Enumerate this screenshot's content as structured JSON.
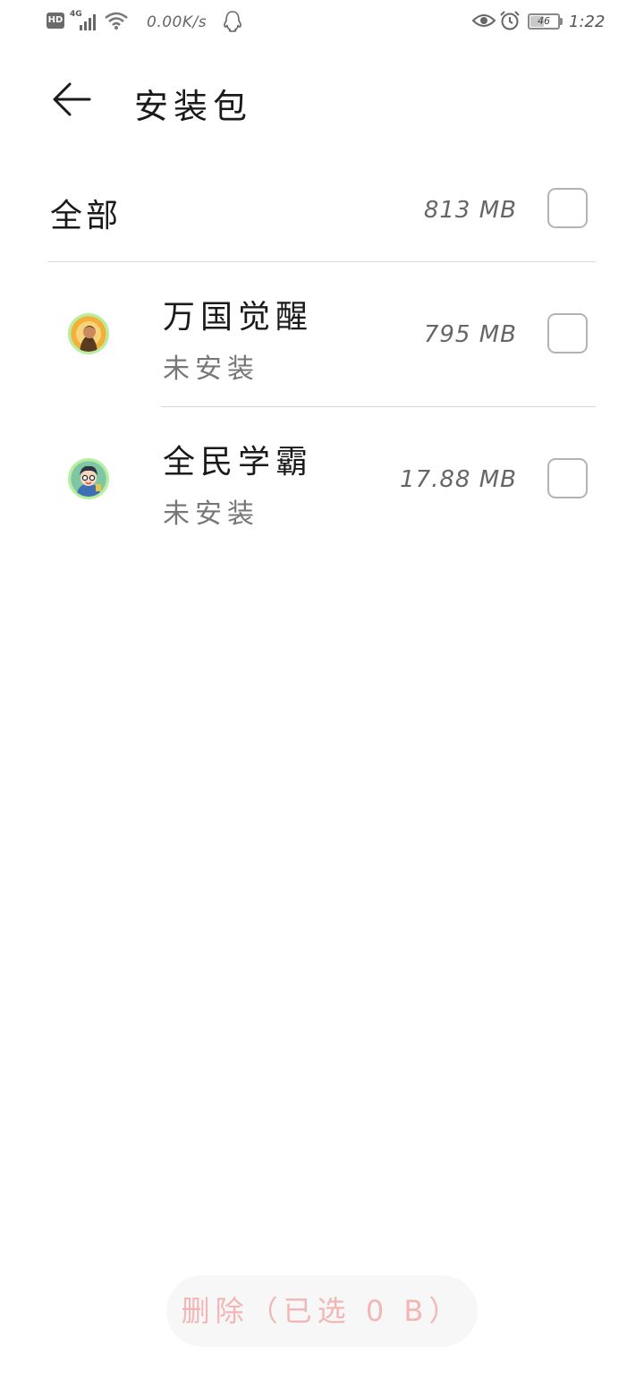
{
  "status_bar": {
    "hd": "HD",
    "network_type": "4G",
    "net_speed": "0.00K/s",
    "battery": "46",
    "battery_level": 0.46,
    "time": "1:22"
  },
  "header": {
    "title": "安装包"
  },
  "all": {
    "label": "全部",
    "size": "813 MB",
    "checked": false
  },
  "apps": [
    {
      "name": "万国觉醒",
      "status": "未安装",
      "size": "795 MB",
      "checked": false,
      "icon": "rise-of-kingdoms-app-icon"
    },
    {
      "name": "全民学霸",
      "status": "未安装",
      "size": "17.88 MB",
      "checked": false,
      "icon": "quanmin-xueba-app-icon"
    }
  ],
  "footer": {
    "delete_label": "删除（已选 0 B）"
  },
  "colors": {
    "accent_disabled": "#f3b6b6",
    "checkbox_border": "#b3b3b3",
    "icon_ring": "#b6ef9c"
  }
}
